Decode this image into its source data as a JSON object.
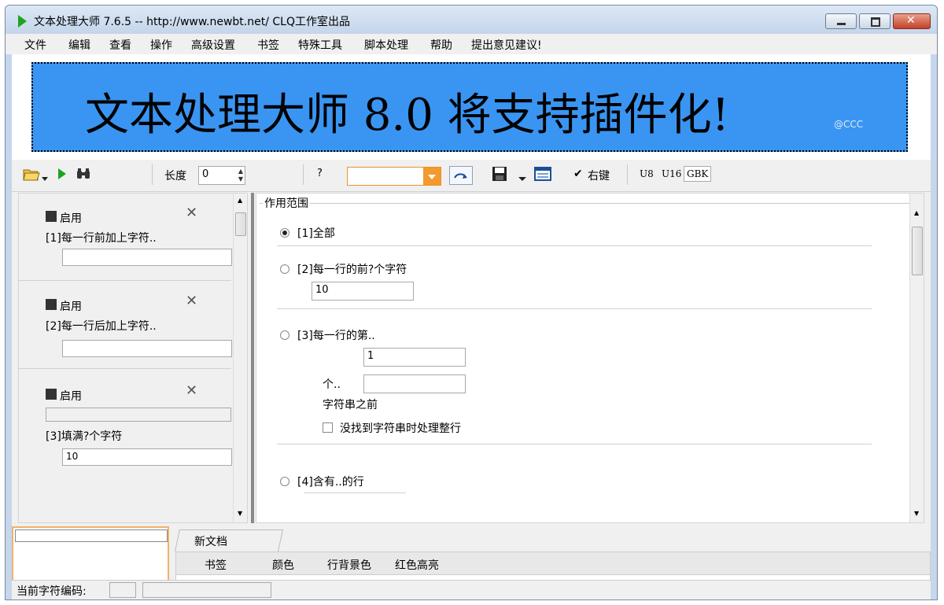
{
  "window": {
    "title": "文本处理大师 7.6.5 -- http://www.newbt.net/  CLQ工作室出品"
  },
  "menu": [
    "文件",
    "编辑",
    "查看",
    "操作",
    "高级设置",
    "书签",
    "特殊工具",
    "脚本处理",
    "帮助",
    "提出意见建议!"
  ],
  "banner": {
    "text": "文本处理大师  8.0  将支持插件化!",
    "small": "@CCC",
    "color": "#3a95f2"
  },
  "toolbar": {
    "length_label": "长度",
    "length_value": "0",
    "help_label": "?",
    "right_key_label": "右键",
    "enc_u8": "U8",
    "enc_u16": "U16",
    "enc_gbk": "GBK"
  },
  "left_cards": [
    {
      "enable": "启用",
      "label": "[1]每一行前加上字符..",
      "value": ""
    },
    {
      "enable": "启用",
      "label": "[2]每一行后加上字符..",
      "value": ""
    },
    {
      "enable": "启用",
      "label": "[3]填满?个字符",
      "value": "10"
    }
  ],
  "scope": {
    "title": "作用范围",
    "opt1": "[1]全部",
    "opt2": "[2]每一行的前?个字符",
    "opt2_value": "10",
    "opt3": "[3]每一行的第..",
    "opt3_value1": "1",
    "opt3_ge": "个..",
    "opt3_value2": "",
    "opt3_before": "字符串之前",
    "opt3_check": "没找到字符串时处理整行",
    "opt4": "[4]含有..的行"
  },
  "tabs": {
    "doc": "新文档"
  },
  "list_columns": [
    "书签",
    "颜色",
    "行背景色",
    "红色高亮"
  ],
  "status": {
    "encoding_label": "当前字符编码:"
  },
  "colors": {
    "accent_orange": "#f29a2e",
    "title_bg": "#c6d6ec"
  }
}
